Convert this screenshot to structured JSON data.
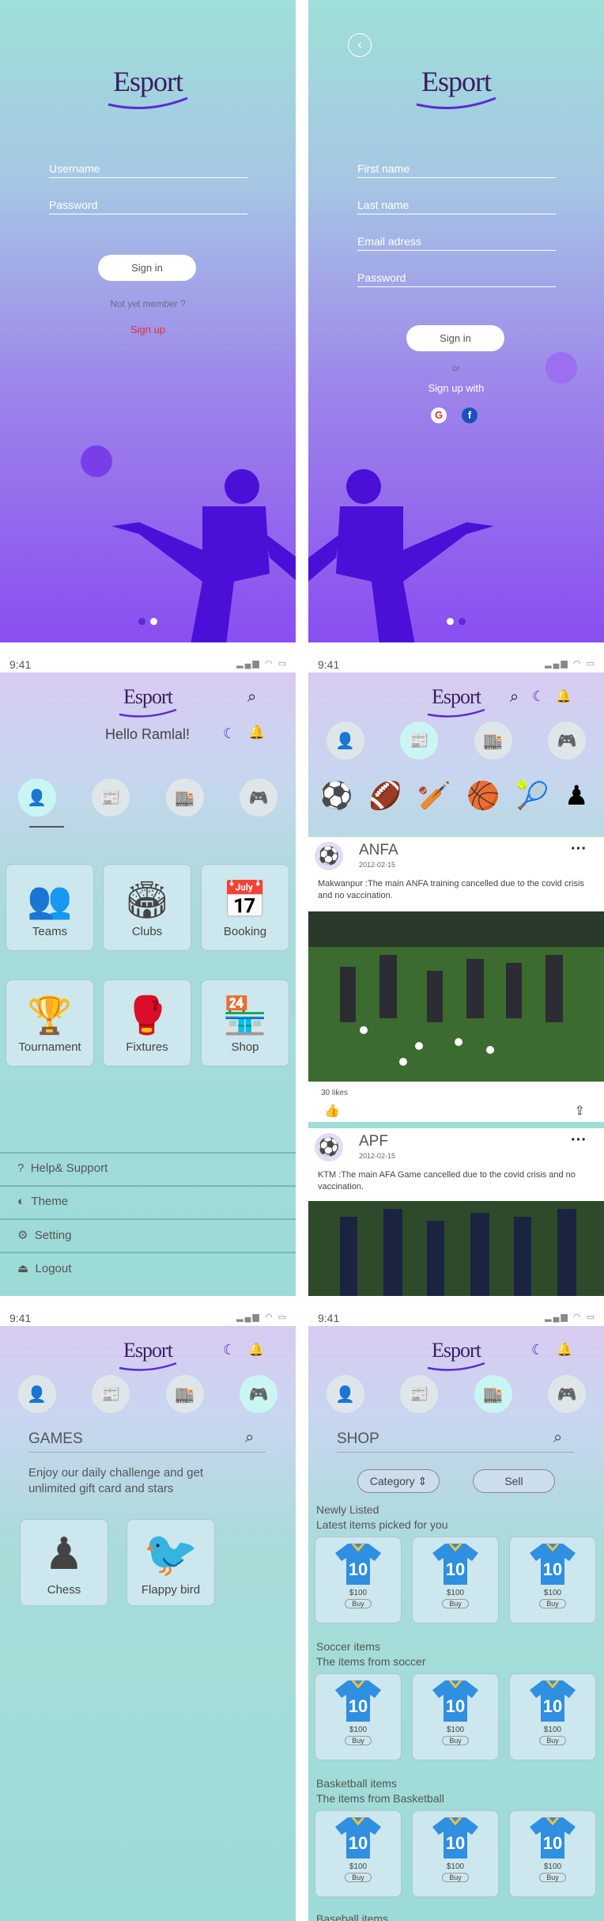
{
  "login": {
    "logo": "Esport",
    "username_placeholder": "Username",
    "password_placeholder": "Password",
    "signin": "Sign in",
    "not_member": "Not yet member ?",
    "signup": "Sign up"
  },
  "signup": {
    "logo": "Esport",
    "first": "First name",
    "last": "Last name",
    "email": "Email adress",
    "password": "Password",
    "signin": "Sign in",
    "or": "or",
    "signup_with": "Sign up with",
    "google": "G",
    "facebook": "f"
  },
  "home": {
    "time": "9:41",
    "logo": "Esport",
    "greeting": "Hello Ramlal!",
    "tiles": [
      {
        "label": "Teams",
        "icon": "👥"
      },
      {
        "label": "Clubs",
        "icon": "🏟"
      },
      {
        "label": "Booking",
        "icon": "📅"
      },
      {
        "label": "Tournament",
        "icon": "🏆"
      },
      {
        "label": "Fixtures",
        "icon": "🥊"
      },
      {
        "label": "Shop",
        "icon": "🏪"
      }
    ],
    "menu": [
      {
        "label": "Help& Support",
        "icon": "?"
      },
      {
        "label": "Theme",
        "icon": "◐"
      },
      {
        "label": "Setting",
        "icon": "⚙"
      },
      {
        "label": "Logout",
        "icon": "⏏"
      }
    ]
  },
  "feed": {
    "time": "9:41",
    "logo": "Esport",
    "categories": [
      "⚽",
      "🏈",
      "🏏",
      "🏀",
      "🎾",
      "♟"
    ],
    "posts": [
      {
        "name": "ANFA",
        "date": "2012-02-15",
        "text": "Makwanpur :The main ANFA training cancelled due to the covid crisis and no vaccination.",
        "likes": "30 likes"
      },
      {
        "name": "APF",
        "date": "2012-02-15",
        "text": "KTM :The main AFA Game cancelled due to the covid crisis and no vaccination."
      }
    ]
  },
  "games": {
    "time": "9:41",
    "logo": "Esport",
    "title": "GAMES",
    "desc": "Enjoy our daily challenge and get unlimited gift card and stars",
    "items": [
      {
        "label": "Chess",
        "icon": "♟"
      },
      {
        "label": "Flappy bird",
        "icon": "🐦"
      }
    ]
  },
  "shop": {
    "time": "9:41",
    "logo": "Esport",
    "title": "SHOP",
    "category": "Category",
    "sell": "Sell",
    "sections": [
      {
        "title": "Newly Listed",
        "sub": "Latest items picked for you"
      },
      {
        "title": "Soccer items",
        "sub": "The items from soccer"
      },
      {
        "title": "Basketball items",
        "sub": "The items from Basketball"
      },
      {
        "title": "Baseball items"
      }
    ],
    "price": "$100",
    "buy": "Buy",
    "number": "10"
  },
  "colors": {
    "purple": "#5b2bd6",
    "accent": "#c9f6f3",
    "red": "#e0303a"
  }
}
